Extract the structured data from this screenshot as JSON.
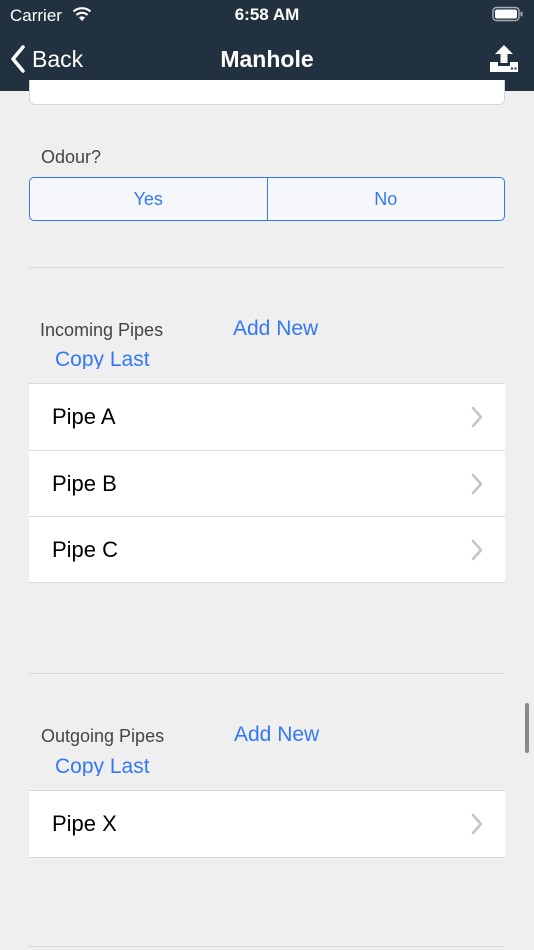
{
  "status": {
    "carrier": "Carrier",
    "time": "6:58 AM"
  },
  "nav": {
    "back_label": "Back",
    "title": "Manhole"
  },
  "odour": {
    "label": "Odour?",
    "options": [
      "Yes",
      "No"
    ]
  },
  "incoming": {
    "label": "Incoming Pipes",
    "add_new": "Add New",
    "copy_last": "Copy Last",
    "items": [
      "Pipe A",
      "Pipe B",
      "Pipe C"
    ]
  },
  "outgoing": {
    "label": "Outgoing Pipes",
    "add_new": "Add New",
    "copy_last": "Copy Last",
    "items": [
      "Pipe X"
    ]
  },
  "colors": {
    "nav_bg": "#22313f",
    "accent": "#3478f6",
    "background": "#efefef"
  }
}
